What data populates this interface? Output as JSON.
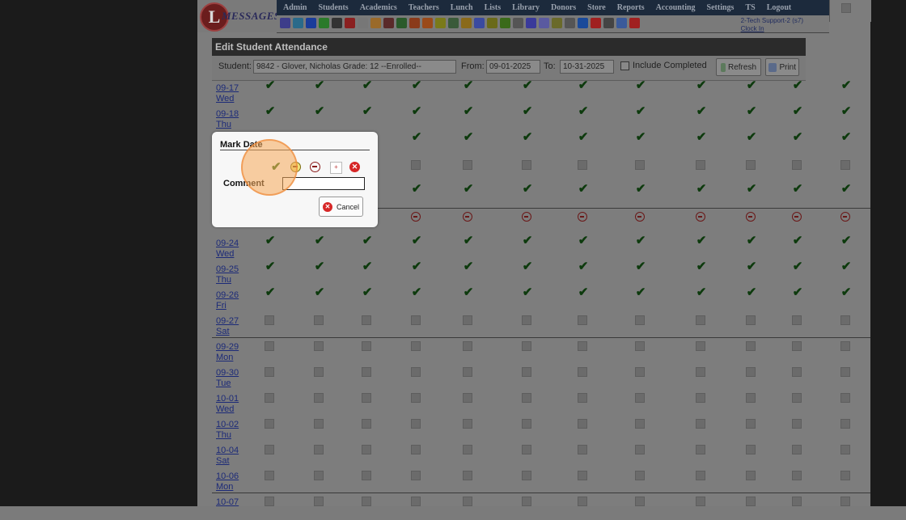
{
  "app": {
    "logo_letter": "L",
    "logo_word": "MESSAGES"
  },
  "nav": {
    "items": [
      "Admin",
      "Students",
      "Academics",
      "Teachers",
      "Lunch",
      "Lists",
      "Library",
      "Donors",
      "Store",
      "Reports",
      "Accounting",
      "Settings",
      "TS",
      "Logout"
    ]
  },
  "toolbar": {
    "user": "2-Tech Support-2 (s7)",
    "clock_in": "Clock In",
    "icon_colors": [
      "#3d3d8a",
      "#2a6a8a",
      "#1a3c9a",
      "#2a7a2a",
      "#333",
      "#8a2020",
      "#777",
      "#9a6a2a",
      "#5a2a2a",
      "#2a5a2a",
      "#8a3a1a",
      "#9a4a1a",
      "#7a7a1a",
      "#3a5a3a",
      "#8a6a1a",
      "#3a4aa0",
      "#6a6a1a",
      "#3a6a1a",
      "#555",
      "#3a3a9a",
      "#5a5aa0",
      "#6a6a2a",
      "#555",
      "#1a4a9a",
      "#a02020",
      "#444",
      "#3a5a9a",
      "#a02020"
    ]
  },
  "panel": {
    "title": "Edit Student Attendance",
    "student_label": "Student:",
    "student_value": "9842 - Glover, Nicholas Grade: 12 --Enrolled--",
    "from_label": "From:",
    "from_value": "09-01-2025",
    "to_label": "To:",
    "to_value": "10-31-2025",
    "include_completed_label": "Include Completed",
    "refresh_label": "Refresh",
    "print_label": "Print"
  },
  "grid": {
    "rows": [
      {
        "date": "09-17",
        "day": "Wed",
        "marks": "check"
      },
      {
        "date": "09-18",
        "day": "Thu",
        "marks": "check"
      },
      {
        "date": "",
        "day": "",
        "marks": "check"
      },
      {
        "date": "",
        "day": "",
        "marks": "box"
      },
      {
        "date": "",
        "day": "",
        "marks": "check"
      },
      {
        "date": "",
        "day": "",
        "marks": "minus"
      },
      {
        "date": "09-24",
        "day": "Wed",
        "marks": "check"
      },
      {
        "date": "09-25",
        "day": "Thu",
        "marks": "check"
      },
      {
        "date": "09-26",
        "day": "Fri",
        "marks": "check"
      },
      {
        "date": "09-27",
        "day": "Sat",
        "marks": "box"
      },
      {
        "date": "09-29",
        "day": "Mon",
        "marks": "box"
      },
      {
        "date": "09-30",
        "day": "Tue",
        "marks": "box"
      },
      {
        "date": "10-01",
        "day": "Wed",
        "marks": "box"
      },
      {
        "date": "10-02",
        "day": "Thu",
        "marks": "box"
      },
      {
        "date": "10-04",
        "day": "Sat",
        "marks": "box"
      },
      {
        "date": "10-06",
        "day": "Mon",
        "marks": "box"
      },
      {
        "date": "10-07",
        "day": "",
        "marks": "box"
      }
    ]
  },
  "modal": {
    "title": "Mark Date",
    "comment_label": "Comment",
    "comment_value": "",
    "cancel_label": "Cancel",
    "tardy_glyph": "+",
    "clear_glyph": "✕"
  }
}
